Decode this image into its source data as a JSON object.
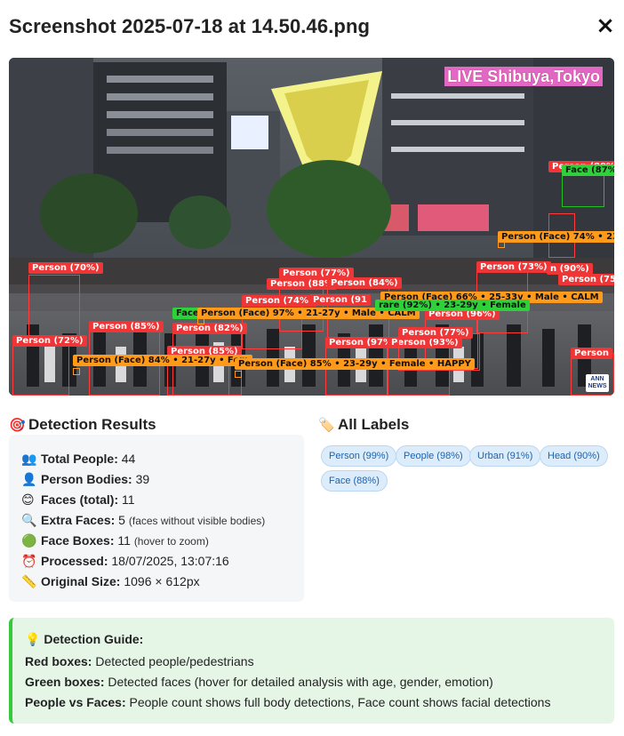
{
  "dialog": {
    "title": "Screenshot 2025-07-18 at 14.50.46.png",
    "close_icon": "×"
  },
  "image": {
    "overlay_text": "LIVE Shibuya,Tokyo",
    "corner_logo": "ANN NEWS",
    "labels": {
      "p70": "Person (70%)",
      "p77a": "Person (77%)",
      "p88": "Person (88%",
      "p84": "Person (84%)",
      "p73": "Person (73%)",
      "p90": "n (90%)",
      "p75": "Person (75%",
      "p74a": "Person (74%)",
      "p91": "Person (91",
      "p96": "Person (96%)",
      "p85a": "Person (85%)",
      "p82": "Person (82%)",
      "p72": "Person (72%)",
      "p85b": "Person (85%)",
      "p97": "Person (97%",
      "p93": "Person (93%)",
      "p77b": "Person (77%)",
      "p80": "Person (80%)",
      "pright": "Person",
      "f87": "Face (87%",
      "pface74": "Person (Face) 74% • 23-",
      "pface66": "Person (Face) 66% • 25-33y • Male • CALM",
      "pface97": "Person (Face) 97% • 21-27y • Male • CALM",
      "pface92": "rare (92%) • 23-29y • Female",
      "pface84": "Person (Face) 84% • 21-27y • Fem",
      "pface85": "Person (Face) 85% • 23-29y • Female • HAPPY",
      "face_small": "Face"
    }
  },
  "detection_results": {
    "heading_icon": "🎯",
    "heading": "Detection Results",
    "rows": [
      {
        "icon": "👥",
        "label": "Total People:",
        "value": "44",
        "note": ""
      },
      {
        "icon": "👤",
        "label": "Person Bodies:",
        "value": "39",
        "note": ""
      },
      {
        "icon": "😊",
        "label": "Faces (total):",
        "value": "11",
        "note": ""
      },
      {
        "icon": "🔍",
        "label": "Extra Faces:",
        "value": "5",
        "note": "(faces without visible bodies)"
      },
      {
        "icon": "🟢",
        "label": "Face Boxes:",
        "value": "11",
        "note": "(hover to zoom)"
      },
      {
        "icon": "⏰",
        "label": "Processed:",
        "value": "18/07/2025, 13:07:16",
        "note": ""
      },
      {
        "icon": "📏",
        "label": "Original Size:",
        "value": "1096 × 612px",
        "note": ""
      }
    ]
  },
  "all_labels": {
    "heading_icon": "🏷️",
    "heading": "All Labels",
    "chips": [
      "Person (99%)",
      "People (98%)",
      "Urban (91%)",
      "Head (90%)",
      "Face (88%)"
    ]
  },
  "guide": {
    "title_icon": "💡",
    "title": "Detection Guide:",
    "lines": [
      {
        "label": "Red boxes:",
        "text": "Detected people/pedestrians"
      },
      {
        "label": "Green boxes:",
        "text": "Detected faces (hover for detailed analysis with age, gender, emotion)"
      },
      {
        "label": "People vs Faces:",
        "text": "People count shows full body detections, Face count shows facial detections"
      }
    ]
  },
  "colors": {
    "person_box": "#ef3535",
    "face_box": "#ff9a1a",
    "green_face_box": "#2fd13b",
    "chip_bg": "#dcecfb",
    "chip_text": "#2163a8",
    "guide_bg": "#e6f6e6",
    "guide_border": "#37c93d"
  }
}
